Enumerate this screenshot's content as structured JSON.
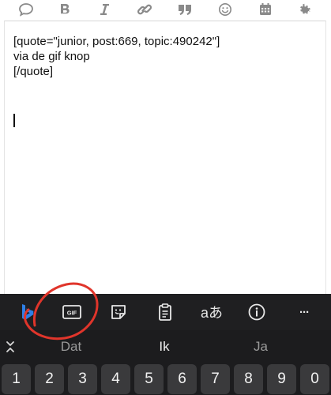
{
  "toolbar": {
    "items": [
      {
        "name": "reply-icon"
      },
      {
        "name": "bold-icon"
      },
      {
        "name": "italic-icon"
      },
      {
        "name": "link-icon"
      },
      {
        "name": "quote-icon"
      },
      {
        "name": "emoji-icon"
      },
      {
        "name": "calendar-icon"
      },
      {
        "name": "gear-icon"
      }
    ],
    "icon_color": "#8a8a8a"
  },
  "editor": {
    "text": "[quote=\"junior, post:669, topic:490242\"]\nvia de gif knop\n[/quote]"
  },
  "keyboard": {
    "tools": [
      {
        "name": "bing-icon"
      },
      {
        "name": "gif-icon",
        "label": "GIF"
      },
      {
        "name": "sticker-icon"
      },
      {
        "name": "clipboard-icon"
      },
      {
        "name": "translate-icon",
        "label": "aあ"
      },
      {
        "name": "info-icon"
      },
      {
        "name": "more-icon",
        "label": "···"
      }
    ],
    "suggestions": {
      "left": "Dat",
      "middle": "Ik",
      "right": "Ja"
    },
    "number_keys": [
      "1",
      "2",
      "3",
      "4",
      "5",
      "6",
      "7",
      "8",
      "9",
      "0"
    ],
    "background": "#1c1c1e"
  },
  "annotation": {
    "color": "#e0352b"
  }
}
